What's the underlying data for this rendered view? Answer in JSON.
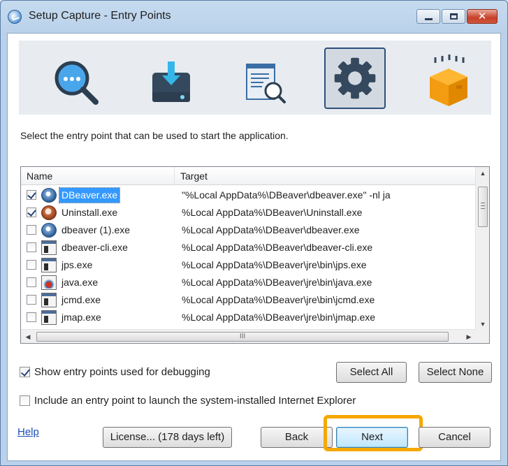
{
  "window": {
    "title": "Setup Capture - Entry Points",
    "close_glyph": "✕"
  },
  "banner": {
    "steps": [
      {
        "icon": "search-dots-icon"
      },
      {
        "icon": "download-drive-icon"
      },
      {
        "icon": "document-search-icon"
      },
      {
        "icon": "gear-icon",
        "active": true
      },
      {
        "icon": "package-box-icon"
      }
    ]
  },
  "instruction": "Select the entry point that can be used to start the application.",
  "list": {
    "columns": [
      "Name",
      "Target"
    ],
    "rows": [
      {
        "checked": true,
        "icon": "dbeaver-icon",
        "name": "DBeaver.exe",
        "target": "\"%Local AppData%\\DBeaver\\dbeaver.exe\" -nl ja",
        "selected": true
      },
      {
        "checked": true,
        "icon": "uninstall-icon",
        "name": "Uninstall.exe",
        "target": "%Local AppData%\\DBeaver\\Uninstall.exe"
      },
      {
        "checked": false,
        "icon": "dbeaver-icon",
        "name": "dbeaver (1).exe",
        "target": "%Local AppData%\\DBeaver\\dbeaver.exe"
      },
      {
        "checked": false,
        "icon": "exe-icon",
        "name": "dbeaver-cli.exe",
        "target": "%Local AppData%\\DBeaver\\dbeaver-cli.exe"
      },
      {
        "checked": false,
        "icon": "exe-icon",
        "name": "jps.exe",
        "target": "%Local AppData%\\DBeaver\\jre\\bin\\jps.exe"
      },
      {
        "checked": false,
        "icon": "java-icon",
        "name": "java.exe",
        "target": "%Local AppData%\\DBeaver\\jre\\bin\\java.exe"
      },
      {
        "checked": false,
        "icon": "exe-icon",
        "name": "jcmd.exe",
        "target": "%Local AppData%\\DBeaver\\jre\\bin\\jcmd.exe"
      },
      {
        "checked": false,
        "icon": "exe-icon",
        "name": "jmap.exe",
        "target": "%Local AppData%\\DBeaver\\jre\\bin\\jmap.exe"
      }
    ],
    "hscroll_grip": "III"
  },
  "options": {
    "show_debug": {
      "label": "Show entry points used for debugging",
      "checked": true
    },
    "include_ie": {
      "label": "Include an entry point to launch the system-installed Internet Explorer",
      "checked": false
    }
  },
  "buttons": {
    "select_all": "Select All",
    "select_none": "Select None",
    "license": "License... (178 days left)",
    "back": "Back",
    "next": "Next",
    "cancel": "Cancel"
  },
  "help_link": "Help"
}
